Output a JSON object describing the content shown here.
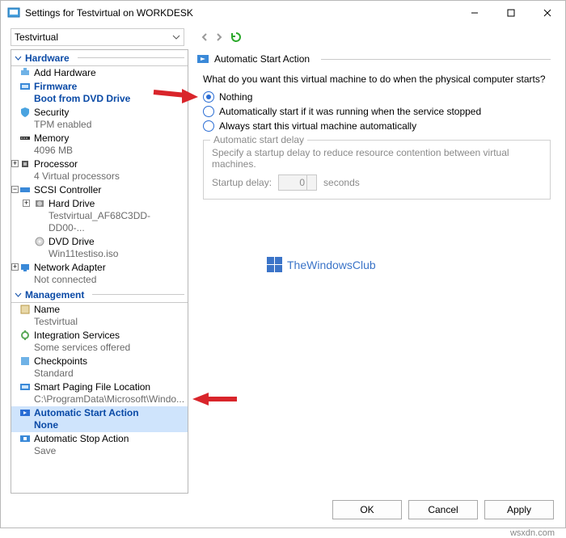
{
  "titlebar": {
    "text": "Settings for Testvirtual on WORKDESK"
  },
  "toolbar": {
    "vm_name": "Testvirtual"
  },
  "sections": {
    "hardware": "Hardware",
    "management": "Management"
  },
  "tree": {
    "add_hardware": "Add Hardware",
    "firmware": {
      "label": "Firmware",
      "sub": "Boot from DVD Drive"
    },
    "security": {
      "label": "Security",
      "sub": "TPM enabled"
    },
    "memory": {
      "label": "Memory",
      "sub": "4096 MB"
    },
    "processor": {
      "label": "Processor",
      "sub": "4 Virtual processors"
    },
    "scsi": {
      "label": "SCSI Controller"
    },
    "harddrive": {
      "label": "Hard Drive",
      "sub": "Testvirtual_AF68C3DD-DD00-..."
    },
    "dvd": {
      "label": "DVD Drive",
      "sub": "Win11testiso.iso"
    },
    "net": {
      "label": "Network Adapter",
      "sub": "Not connected"
    },
    "name": {
      "label": "Name",
      "sub": "Testvirtual"
    },
    "integ": {
      "label": "Integration Services",
      "sub": "Some services offered"
    },
    "check": {
      "label": "Checkpoints",
      "sub": "Standard"
    },
    "paging": {
      "label": "Smart Paging File Location",
      "sub": "C:\\ProgramData\\Microsoft\\Windo..."
    },
    "start": {
      "label": "Automatic Start Action",
      "sub": "None"
    },
    "stop": {
      "label": "Automatic Stop Action",
      "sub": "Save"
    }
  },
  "panel": {
    "title": "Automatic Start Action",
    "prompt": "What do you want this virtual machine to do when the physical computer starts?",
    "opt_nothing": "Nothing",
    "opt_auto_if_running": "Automatically start if it was running when the service stopped",
    "opt_always": "Always start this virtual machine automatically",
    "group_legend": "Automatic start delay",
    "group_text": "Specify a startup delay to reduce resource contention between virtual machines.",
    "delay_label": "Startup delay:",
    "delay_value": "0",
    "delay_unit": "seconds"
  },
  "footer": {
    "ok": "OK",
    "cancel": "Cancel",
    "apply": "Apply"
  },
  "watermark": "TheWindowsClub",
  "caption": "wsxdn.com"
}
